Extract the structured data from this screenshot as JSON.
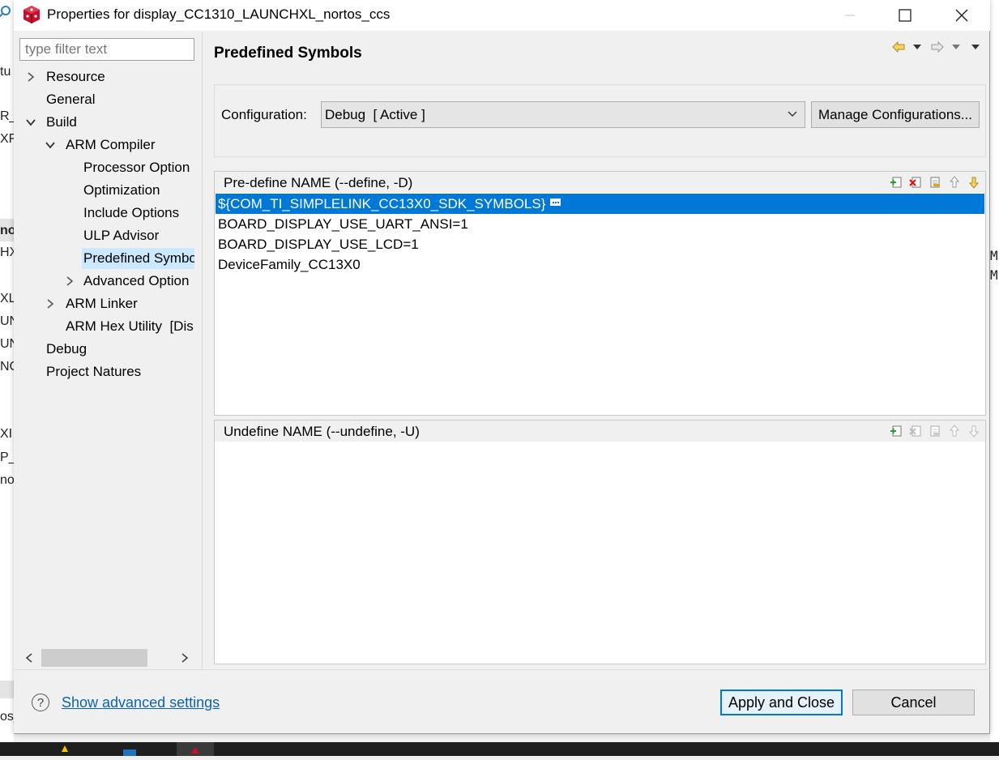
{
  "dialog": {
    "title": "Properties for display_CC1310_LAUNCHXL_nortos_ccs"
  },
  "filter": {
    "placeholder": "type filter text"
  },
  "tree": {
    "items": [
      {
        "label": "Resource"
      },
      {
        "label": "General"
      },
      {
        "label": "Build"
      },
      {
        "label": "ARM Compiler"
      },
      {
        "label": "Processor Option"
      },
      {
        "label": "Optimization"
      },
      {
        "label": "Include Options"
      },
      {
        "label": "ULP Advisor"
      },
      {
        "label": "Predefined Symbo"
      },
      {
        "label": "Advanced Option"
      },
      {
        "label": "ARM Linker"
      },
      {
        "label": "ARM Hex Utility  [Dis"
      },
      {
        "label": "Debug"
      },
      {
        "label": "Project Natures"
      }
    ]
  },
  "page": {
    "title": "Predefined Symbols"
  },
  "config": {
    "label": "Configuration:",
    "value": "Debug  [ Active ]",
    "manage_label": "Manage Configurations..."
  },
  "predefine": {
    "header": "Pre-define NAME (--define, -D)",
    "items": [
      "${COM_TI_SIMPLELINK_CC13X0_SDK_SYMBOLS}",
      "BOARD_DISPLAY_USE_UART_ANSI=1",
      "BOARD_DISPLAY_USE_LCD=1",
      "DeviceFamily_CC13X0"
    ]
  },
  "undefine": {
    "header": "Undefine NAME (--undefine, -U)",
    "items": []
  },
  "footer": {
    "advanced_link": "Show advanced settings",
    "apply_close": "Apply and Close",
    "cancel": "Cancel"
  },
  "background": {
    "left_fragments": [
      "tu",
      "R_t",
      "XF",
      "no",
      "HX",
      "XL",
      "UN",
      "UN",
      "NC",
      "XI",
      "P_",
      "no",
      "os_"
    ],
    "right_fragments": [
      "M",
      "M"
    ]
  },
  "colors": {
    "selection": "#0078d7",
    "tree_selection": "#cce8ff",
    "link": "#0a64b4",
    "app_icon": "#c8102e"
  }
}
